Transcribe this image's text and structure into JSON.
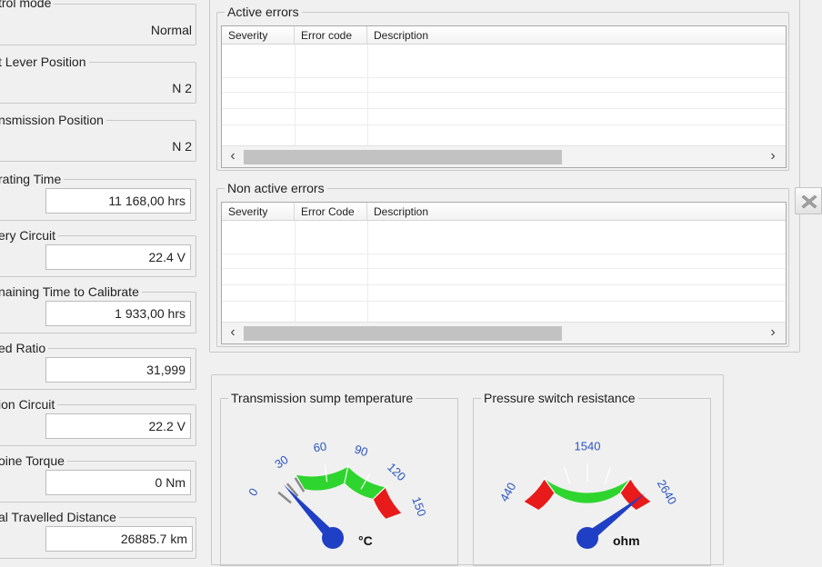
{
  "left_panel": {
    "fields": [
      {
        "label": "trol mode",
        "value": "Normal"
      },
      {
        "label": "t Lever Position",
        "value": "N 2"
      },
      {
        "label": "nsmission Position",
        "value": "N 2"
      },
      {
        "label": "rating Time",
        "value": "11 168,00 hrs"
      },
      {
        "label": "ery Circuit",
        "value": "22.4 V"
      },
      {
        "label": "naining Time to Calibrate",
        "value": "1 933,00 hrs"
      },
      {
        "label": "ed Ratio",
        "value": "31,999"
      },
      {
        "label": "ion Circuit",
        "value": "22.2 V"
      },
      {
        "label": "oine Torque",
        "value": "0 Nm"
      },
      {
        "label": "al Travelled Distance",
        "value": "26885.7 km"
      }
    ]
  },
  "active_errors": {
    "title": "Active errors",
    "columns": [
      "Severity",
      "Error code",
      "Description"
    ],
    "rows": []
  },
  "non_active_errors": {
    "title": "Non active errors",
    "columns": [
      "Severity",
      "Error Code",
      "Description"
    ],
    "rows": []
  },
  "scroll": {
    "left_arrow": "‹",
    "right_arrow": "›"
  },
  "clear_icon": "clear-x-icon",
  "gauges": [
    {
      "title": "Transmission sump temperature",
      "unit": "°C",
      "ticks": [
        "0",
        "30",
        "60",
        "90",
        "120",
        "150"
      ],
      "value": 20,
      "colors": {
        "ok": "#2ed52e",
        "alarm": "#e81a1a",
        "tick_label": "#2a54c4",
        "needle": "#1f3fc4"
      }
    },
    {
      "title": "Pressure switch resistance",
      "unit": "ohm",
      "ticks": [
        "440",
        "1540",
        "2640"
      ],
      "value": 2500,
      "colors": {
        "ok": "#2ed52e",
        "alarm": "#e81a1a",
        "tick_label": "#2a54c4",
        "needle": "#1f3fc4"
      }
    }
  ]
}
